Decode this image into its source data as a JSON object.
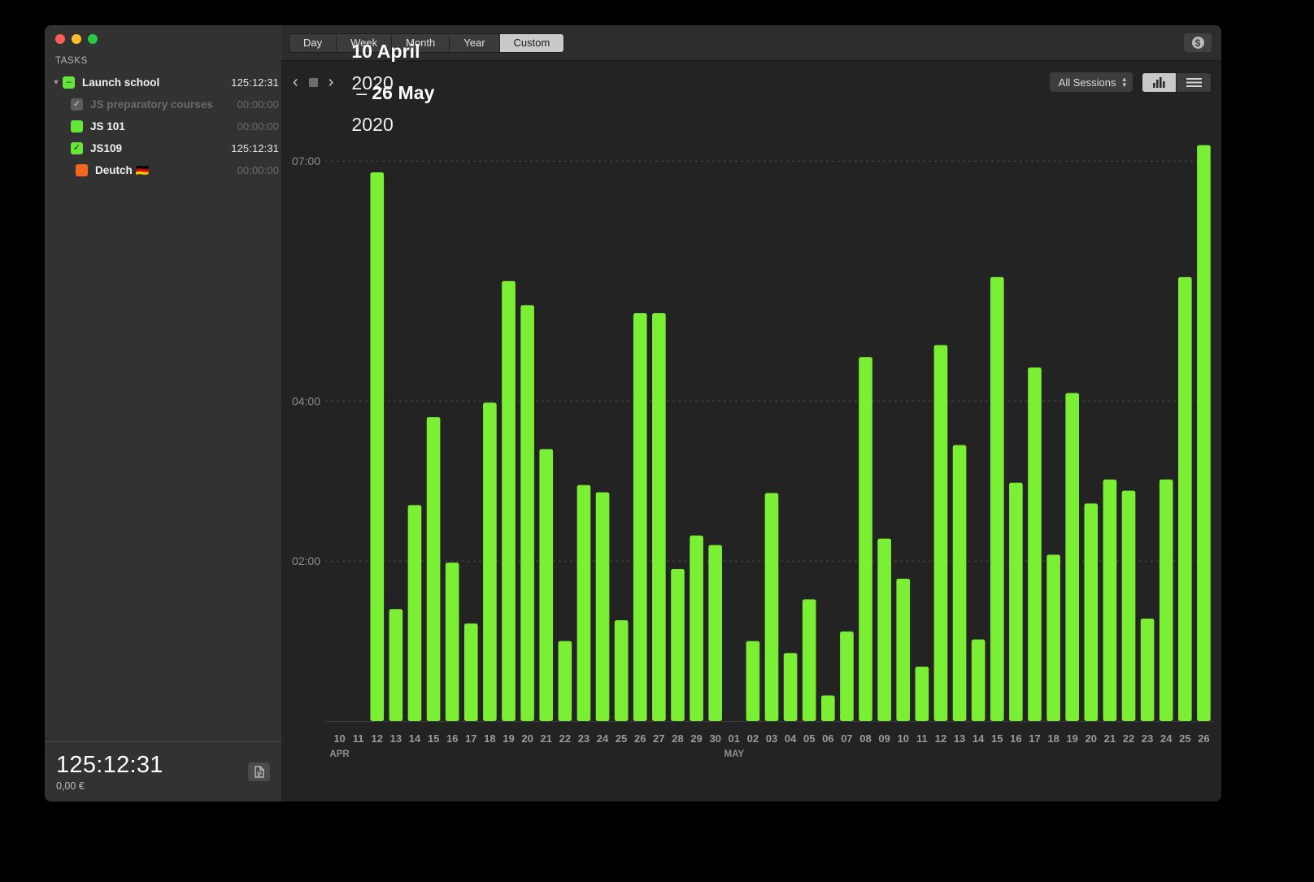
{
  "window": {
    "traffic_lights": [
      "close",
      "minimize",
      "zoom"
    ]
  },
  "sidebar": {
    "header": "TASKS",
    "tasks": [
      {
        "name": "Launch school",
        "time": "125:12:31",
        "color": "green",
        "indent": 0,
        "disclosure": "▼",
        "check": "–",
        "dim": false
      },
      {
        "name": "JS preparatory courses",
        "time": "00:00:00",
        "color": "grey",
        "indent": 1,
        "disclosure": "",
        "check": "✓",
        "dim": true
      },
      {
        "name": "JS 101",
        "time": "00:00:00",
        "color": "green",
        "indent": 1,
        "disclosure": "",
        "check": "",
        "dim": false
      },
      {
        "name": "JS109",
        "time": "125:12:31",
        "color": "green",
        "indent": 1,
        "disclosure": "",
        "check": "✓",
        "dim": false
      },
      {
        "name": "Deutch 🇩🇪",
        "time": "00:00:00",
        "color": "orange",
        "indent": 2,
        "disclosure": "",
        "check": "",
        "dim": false
      }
    ],
    "footer": {
      "total_time": "125:12:31",
      "total_money": "0,00 €",
      "report_icon": "document-icon"
    }
  },
  "toolbar": {
    "segments": [
      {
        "label": "Day",
        "active": false
      },
      {
        "label": "Week",
        "active": false
      },
      {
        "label": "Month",
        "active": false
      },
      {
        "label": "Year",
        "active": false
      },
      {
        "label": "Custom",
        "active": true
      }
    ],
    "money_button_icon": "dollar-icon",
    "money_button_glyph": "$"
  },
  "subheader": {
    "prev_icon": "chevron-left-icon",
    "prev_glyph": "‹",
    "stop_icon": "stop-square-icon",
    "next_icon": "chevron-right-icon",
    "next_glyph": "›",
    "range_start_day": "10 April",
    "range_start_year": "2020",
    "range_dash": "–",
    "range_end_day": "26 May",
    "range_end_year": "2020",
    "sessions_label": "All Sessions",
    "stepper_up": "▴",
    "stepper_down": "▾",
    "view_bar_icon": "bar-chart-icon",
    "view_list_icon": "list-view-icon"
  },
  "colors": {
    "bar": "#7bef33",
    "window_bg": "#2a2a2a",
    "chart_bg": "#232323",
    "sidebar_bg": "#323232",
    "grid": "#4a4a4a",
    "axis_text": "#8e8e8e"
  },
  "chart_data": {
    "type": "bar",
    "title": "",
    "xlabel": "",
    "ylabel": "",
    "ylim": [
      0,
      7.5
    ],
    "grid": true,
    "y_ticks": [
      {
        "label": "07:00",
        "value": 7
      },
      {
        "label": "04:00",
        "value": 4
      },
      {
        "label": "02:00",
        "value": 2
      }
    ],
    "month_labels": [
      {
        "label": "APR",
        "index": 0
      },
      {
        "label": "MAY",
        "index": 21
      }
    ],
    "categories": [
      "10",
      "11",
      "12",
      "13",
      "14",
      "15",
      "16",
      "17",
      "18",
      "19",
      "20",
      "21",
      "22",
      "23",
      "24",
      "25",
      "26",
      "27",
      "28",
      "29",
      "30",
      "01",
      "02",
      "03",
      "04",
      "05",
      "06",
      "07",
      "08",
      "09",
      "10",
      "11",
      "12",
      "13",
      "14",
      "15",
      "16",
      "17",
      "18",
      "19",
      "20",
      "21",
      "22",
      "23",
      "24",
      "25",
      "26"
    ],
    "values": [
      0,
      0,
      6.86,
      1.4,
      2.7,
      3.8,
      1.98,
      1.22,
      3.98,
      5.5,
      5.2,
      3.4,
      1.0,
      2.95,
      2.86,
      1.26,
      5.1,
      5.1,
      1.9,
      2.32,
      2.2,
      0,
      1.0,
      2.85,
      0.85,
      1.52,
      0.32,
      1.12,
      4.55,
      2.28,
      1.78,
      0.68,
      4.7,
      3.45,
      1.02,
      5.55,
      2.98,
      4.42,
      2.08,
      4.1,
      2.72,
      3.02,
      2.88,
      1.28,
      3.02,
      5.55,
      7.2
    ]
  }
}
